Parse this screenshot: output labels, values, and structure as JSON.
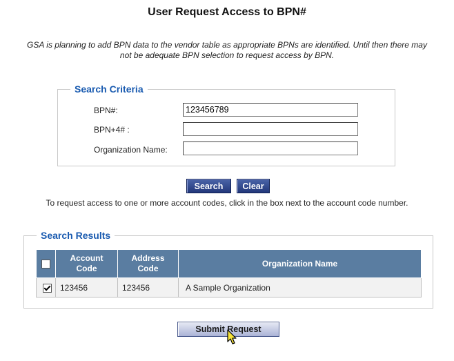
{
  "page": {
    "title": "User Request Access to BPN#",
    "notice": "GSA is planning to add BPN data to the vendor table as appropriate BPNs are identified. Until then there may not be adequate BPN selection to request access by BPN."
  },
  "search_criteria": {
    "legend": "Search Criteria",
    "bpn_label": "BPN#:",
    "bpn_value": "123456789",
    "bpn4_label": "BPN+4# :",
    "bpn4_value": "",
    "org_label": "Organization Name:",
    "org_value": "",
    "search_button": "Search",
    "clear_button": "Clear"
  },
  "instruction": "To request access to one or more account codes, click in the box next to the account code number.",
  "search_results": {
    "legend": "Search Results",
    "columns": {
      "account_code_line1": "Account",
      "account_code_line2": "Code",
      "address_code_line1": "Address",
      "address_code_line2": "Code",
      "organization_name": "Organization Name"
    },
    "select_all_checked": false,
    "rows": [
      {
        "checked": true,
        "account_code": "123456",
        "address_code": "123456",
        "organization_name": "A Sample Organization"
      }
    ]
  },
  "submit_button": "Submit Request",
  "colors": {
    "legend_text": "#1a5bb0",
    "table_header": "#5a7da1",
    "button_dark": "#22377a"
  }
}
